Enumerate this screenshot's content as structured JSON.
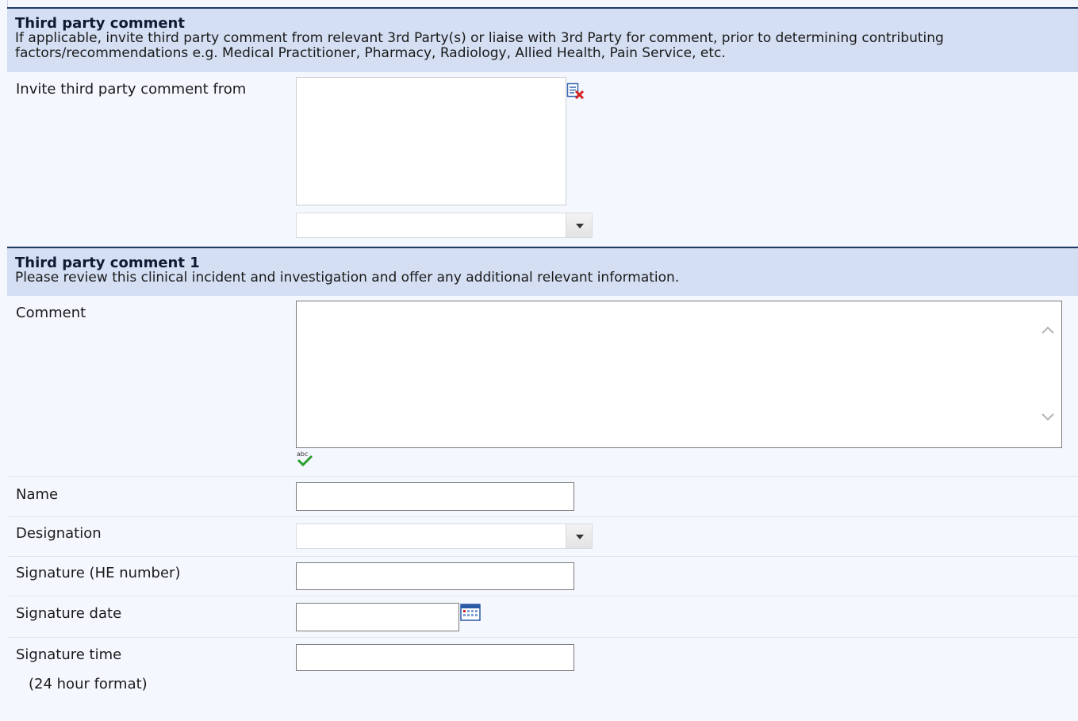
{
  "section1": {
    "title": "Third party comment",
    "description_line1": "If applicable, invite third party comment from relevant 3rd Party(s) or liaise with 3rd Party for comment, prior to determining contributing",
    "description_line2": "factors/recommendations e.g. Medical Practitioner, Pharmacy, Radiology, Allied Health, Pain Service, etc.",
    "invite_label": "Invite third party comment from",
    "invite_list_items": [],
    "invite_select_value": ""
  },
  "section2": {
    "title": "Third party comment 1",
    "description": "Please review this clinical incident and investigation and offer any additional relevant information.",
    "comment_label": "Comment",
    "comment_value": "",
    "name_label": "Name",
    "name_value": "",
    "designation_label": "Designation",
    "designation_value": "",
    "signature_label": "Signature (HE number)",
    "signature_value": "",
    "signature_date_label": "Signature date",
    "signature_date_value": "",
    "signature_time_label": "Signature time",
    "signature_time_hint": "(24 hour format)",
    "signature_time_value": ""
  },
  "icons": {
    "clear_list": "clear-list-icon",
    "spell_check": "spell-check-icon",
    "calendar": "calendar-icon",
    "dropdown": "chevron-down-icon"
  },
  "colors": {
    "header_bg": "#d4dff3",
    "header_border": "#1f3a63",
    "row_bg": "#f4f7fd"
  }
}
